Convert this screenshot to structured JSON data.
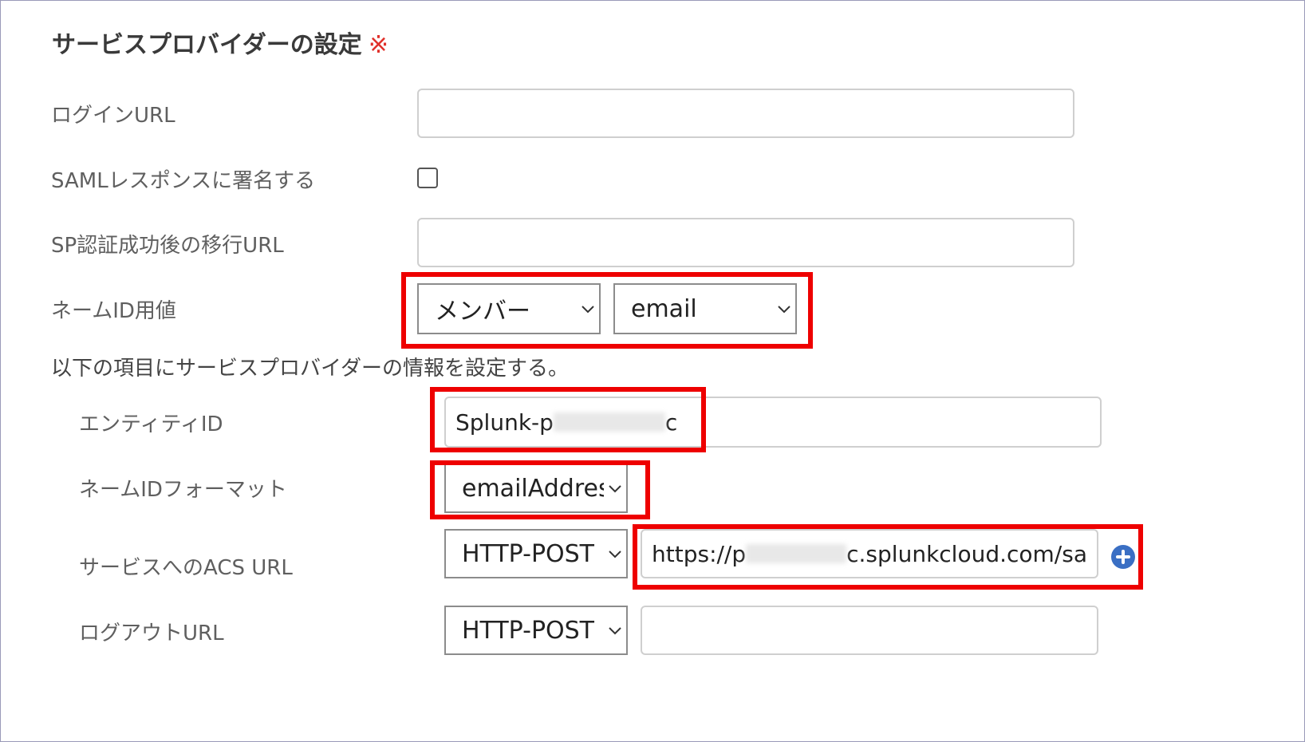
{
  "section": {
    "title": "サービスプロバイダーの設定",
    "required_mark": "※"
  },
  "fields": {
    "login_url": {
      "label": "ログインURL",
      "value": ""
    },
    "saml_sign": {
      "label": "SAMLレスポンスに署名する",
      "checked": false
    },
    "sp_redirect_url": {
      "label": "SP認証成功後の移行URL",
      "value": ""
    },
    "name_id_value": {
      "label": "ネームID用値",
      "select1": "メンバー",
      "select2": "email"
    }
  },
  "sp_info_note": "以下の項目にサービスプロバイダーの情報を設定する。",
  "sp_fields": {
    "entity_id": {
      "label": "エンティティID",
      "value_prefix": "Splunk-p",
      "value_suffix": "c"
    },
    "name_id_format": {
      "label": "ネームIDフォーマット",
      "value": "emailAddress"
    },
    "acs_url": {
      "label": "サービスへのACS URL",
      "binding": "HTTP-POST",
      "value_prefix": "https://p",
      "value_suffix": "c.splunkcloud.com/sa"
    },
    "logout_url": {
      "label": "ログアウトURL",
      "binding": "HTTP-POST",
      "value": ""
    }
  },
  "icons": {
    "chevron": "chevron-down-icon",
    "add": "plus-circle-icon"
  },
  "colors": {
    "highlight": "#ee0000",
    "required": "#e0302a",
    "add_button": "#3a6fc4"
  }
}
